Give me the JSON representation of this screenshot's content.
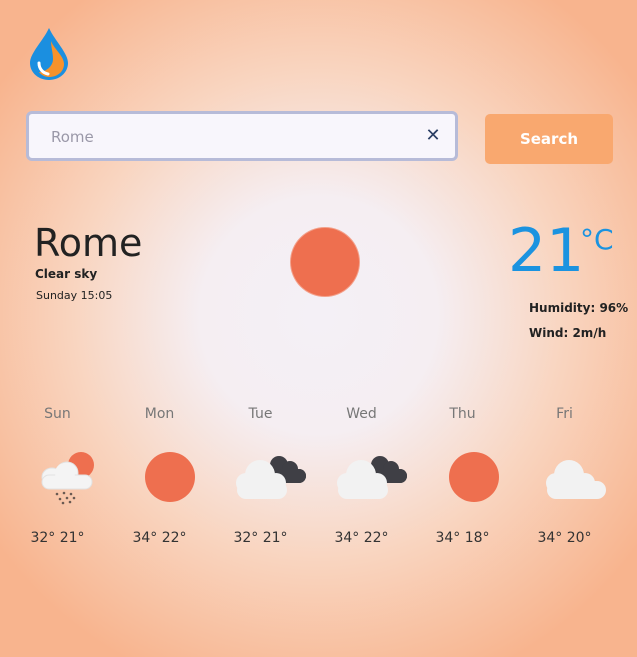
{
  "app": {
    "logo_icon": "water-drop-icon"
  },
  "search": {
    "value": "Rome",
    "placeholder": "",
    "clear_icon": "close-icon",
    "clear_glyph": "✕",
    "button_label": "Search"
  },
  "current": {
    "city": "Rome",
    "condition": "Clear sky",
    "datetime": "Sunday 15:05",
    "icon": "sun-icon",
    "temperature": "21",
    "unit": "°C",
    "humidity": "Humidity: 96%",
    "wind": "Wind: 2m/h"
  },
  "forecast": [
    {
      "day": "Sun",
      "icon": "rain-cloud-sun-icon",
      "temps": "32° 21°"
    },
    {
      "day": "Mon",
      "icon": "sun-icon",
      "temps": "34° 22°"
    },
    {
      "day": "Tue",
      "icon": "cloudy-icon",
      "temps": "32° 21°"
    },
    {
      "day": "Wed",
      "icon": "cloudy-icon",
      "temps": "34° 22°"
    },
    {
      "day": "Thu",
      "icon": "sun-icon",
      "temps": "34° 18°"
    },
    {
      "day": "Fri",
      "icon": "cloud-icon",
      "temps": "34° 20°"
    }
  ],
  "colors": {
    "accent_blue": "#1b93e0",
    "sun": "#ee6f4f",
    "button": "#f9a86f"
  }
}
